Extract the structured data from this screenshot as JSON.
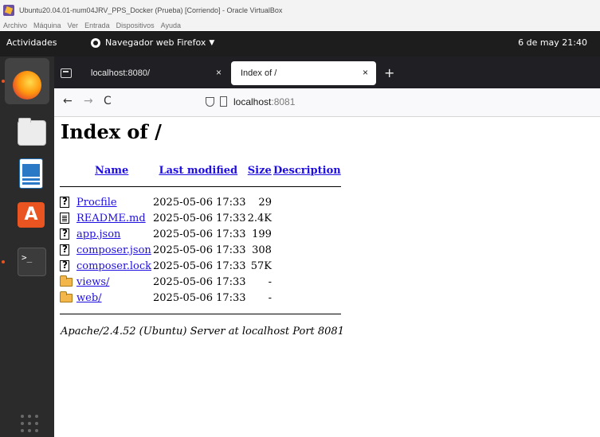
{
  "vbox": {
    "title": "Ubuntu20.04.01-num04JRV_PPS_Docker (Prueba) [Corriendo] - Oracle VirtualBox",
    "menu": [
      "Archivo",
      "Máquina",
      "Ver",
      "Entrada",
      "Dispositivos",
      "Ayuda"
    ]
  },
  "topbar": {
    "activities": "Actividades",
    "app_name": "Navegador web Firefox",
    "clock": "6 de may  21:40"
  },
  "dock": {
    "items": [
      "firefox-icon",
      "files-icon",
      "libreoffice-writer-icon",
      "software-center-icon",
      "terminal-icon",
      "show-applications-icon"
    ],
    "terminal_glyph": ">_",
    "store_glyph": "A"
  },
  "browser": {
    "tabs": [
      {
        "label": "localhost:8080/",
        "active": false
      },
      {
        "label": "Index of /",
        "active": true
      }
    ],
    "tab_close": "×",
    "new_tab": "+",
    "nav": {
      "back": "←",
      "forward": "→",
      "reload": "C"
    },
    "url": {
      "host": "localhost",
      "port": ":8081"
    }
  },
  "page": {
    "heading": "Index of /",
    "columns": {
      "name": "Name",
      "last_modified": "Last modified",
      "size": "Size",
      "description": "Description"
    },
    "rows": [
      {
        "icon": "unknown-file-icon",
        "name": "Procfile",
        "modified": "2025-05-06 17:33",
        "size": "29",
        "description": ""
      },
      {
        "icon": "text-file-icon",
        "name": "README.md",
        "modified": "2025-05-06 17:33",
        "size": "2.4K",
        "description": ""
      },
      {
        "icon": "unknown-file-icon",
        "name": "app.json",
        "modified": "2025-05-06 17:33",
        "size": "199",
        "description": ""
      },
      {
        "icon": "unknown-file-icon",
        "name": "composer.json",
        "modified": "2025-05-06 17:33",
        "size": "308",
        "description": ""
      },
      {
        "icon": "unknown-file-icon",
        "name": "composer.lock",
        "modified": "2025-05-06 17:33",
        "size": "57K",
        "description": ""
      },
      {
        "icon": "folder-icon",
        "name": "views/",
        "modified": "2025-05-06 17:33",
        "size": "-",
        "description": ""
      },
      {
        "icon": "folder-icon",
        "name": "web/",
        "modified": "2025-05-06 17:33",
        "size": "-",
        "description": ""
      }
    ],
    "footer": "Apache/2.4.52 (Ubuntu) Server at localhost Port 8081"
  }
}
